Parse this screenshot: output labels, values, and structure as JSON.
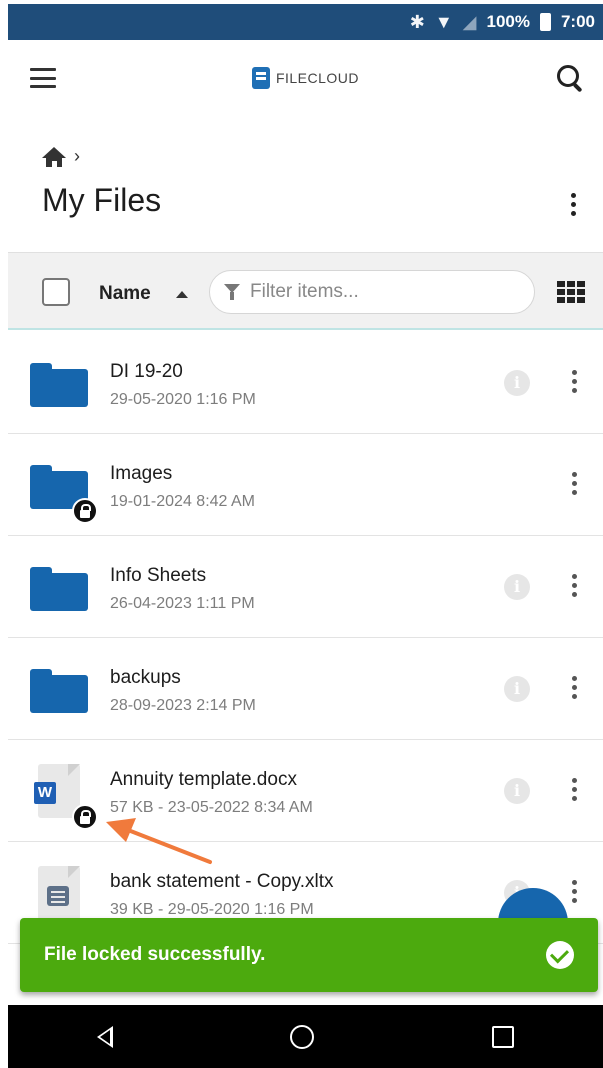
{
  "status_bar": {
    "battery": "100%",
    "time": "7:00",
    "icons": [
      "bluetooth-icon",
      "wifi-icon",
      "signal-icon",
      "battery-icon"
    ]
  },
  "app_bar": {
    "brand": "FILECLOUD",
    "icons": [
      "menu-icon",
      "filecloud-logo-icon",
      "search-icon"
    ]
  },
  "breadcrumb": {
    "home_icon": "home-icon",
    "separator": "›"
  },
  "page": {
    "title": "My Files"
  },
  "toolbar": {
    "sort_label": "Name",
    "filter_placeholder": "Filter items...",
    "view_icon": "grid-view-icon"
  },
  "files": [
    {
      "name": "DI 19-20",
      "meta": "29-05-2020 1:16 PM",
      "type": "folder",
      "locked": false
    },
    {
      "name": "Images",
      "meta": "19-01-2024 8:42 AM",
      "type": "folder",
      "locked": true
    },
    {
      "name": "Info Sheets",
      "meta": "26-04-2023 1:11 PM",
      "type": "folder",
      "locked": false
    },
    {
      "name": "backups",
      "meta": "28-09-2023 2:14 PM",
      "type": "folder",
      "locked": false
    },
    {
      "name": "Annuity template.docx",
      "meta": "57 KB - 23-05-2022 8:34 AM",
      "type": "word",
      "locked": true
    },
    {
      "name": "bank statement - Copy.xltx",
      "meta": "39 KB - 29-05-2020 1:16 PM",
      "type": "doc",
      "locked": false
    }
  ],
  "toast": {
    "message": "File locked successfully."
  },
  "colors": {
    "accent": "#1666ad",
    "status_bar": "#1f4d7a",
    "toast": "#4caa0e",
    "annotation_arrow": "#f07a3c"
  }
}
